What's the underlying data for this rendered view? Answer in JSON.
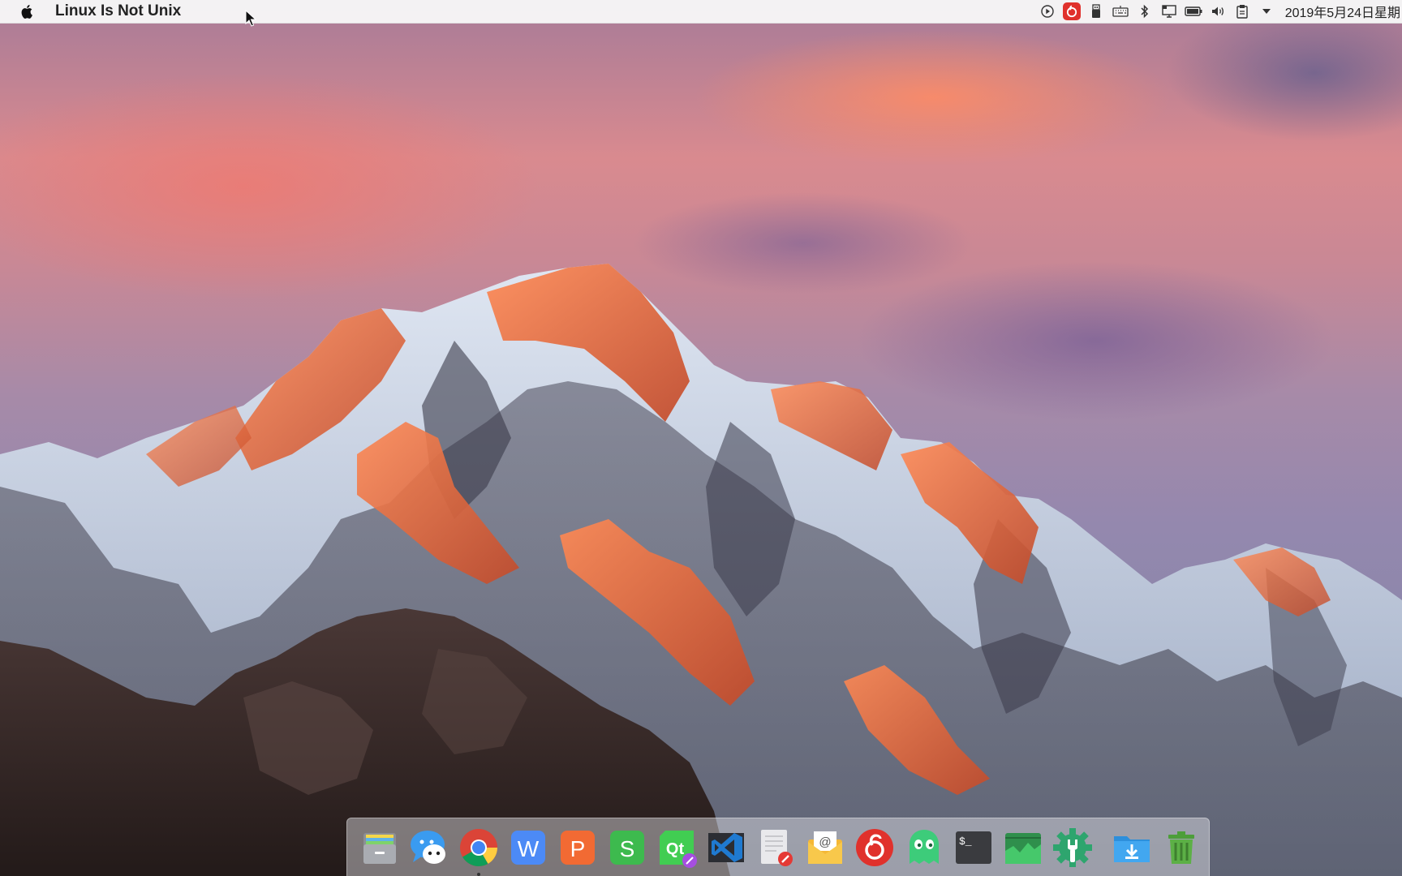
{
  "menubar": {
    "apple_icon": "apple-logo-icon",
    "app_name": "Linux Is Not Unix",
    "clock": "2019年5月24日星期",
    "tray_icons": [
      "media-play-icon",
      "netease-music-icon",
      "usb-drive-icon",
      "keyboard-icon",
      "bluetooth-icon",
      "display-icon",
      "battery-icon",
      "volume-icon",
      "clipboard-icon",
      "dropdown-arrow-icon"
    ],
    "accent_red": "#e0312c"
  },
  "dock": {
    "apps": [
      {
        "name": "files-app",
        "icon": "file-manager-icon"
      },
      {
        "name": "deepin-chat",
        "icon": "chat-bubble-icon"
      },
      {
        "name": "google-chrome",
        "icon": "chrome-icon",
        "running": true
      },
      {
        "name": "wps-writer",
        "icon": "wps-writer-icon",
        "letter": "W"
      },
      {
        "name": "wps-presentation",
        "icon": "wps-presentation-icon",
        "letter": "P"
      },
      {
        "name": "wps-spreadsheet",
        "icon": "wps-spreadsheet-icon",
        "letter": "S"
      },
      {
        "name": "qt-creator",
        "icon": "qt-creator-icon",
        "letter": "Qt"
      },
      {
        "name": "vscode",
        "icon": "vscode-icon"
      },
      {
        "name": "text-editor",
        "icon": "text-editor-icon"
      },
      {
        "name": "mail-client",
        "icon": "mail-icon",
        "letter": "@"
      },
      {
        "name": "netease-cloud-music",
        "icon": "netease-music-icon"
      },
      {
        "name": "ghost-app",
        "icon": "green-ghost-icon"
      },
      {
        "name": "terminal",
        "icon": "terminal-icon",
        "letter": "$_"
      },
      {
        "name": "system-monitor",
        "icon": "system-monitor-icon"
      },
      {
        "name": "settings-tools",
        "icon": "gear-wrench-icon"
      }
    ],
    "trailing": [
      {
        "name": "downloads",
        "icon": "downloads-folder-icon"
      },
      {
        "name": "trash",
        "icon": "trash-icon"
      }
    ]
  }
}
